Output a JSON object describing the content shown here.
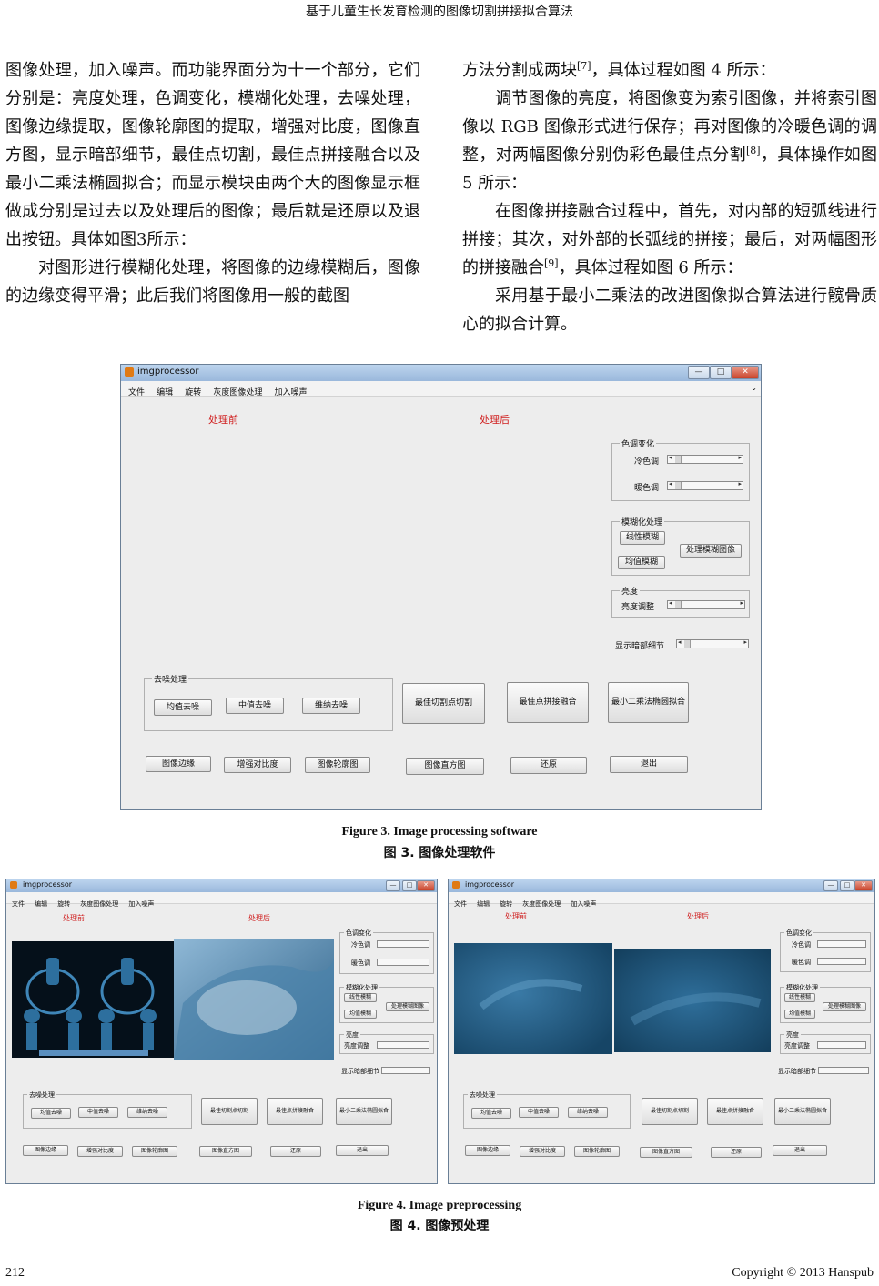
{
  "header": {
    "running_title": "基于儿童生长发育检测的图像切割拼接拟合算法"
  },
  "body": {
    "left": {
      "p1": "图像处理，加入噪声。而功能界面分为十一个部分，它们分别是：亮度处理，色调变化，模糊化处理，去噪处理，图像边缘提取，图像轮廓图的提取，增强对比度，图像直方图，显示暗部细节，最佳点切割，最佳点拼接融合以及最小二乘法椭圆拟合；而显示模块由两个大的图像显示框做成分别是过去以及处理后的图像；最后就是还原以及退出按钮。具体如图3所示：",
      "p2": "对图形进行模糊化处理，将图像的边缘模糊后，图像的边缘变得平滑；此后我们将图像用一般的截图"
    },
    "right": {
      "p1_a": "方法分割成两块",
      "p1_ref": "[7]",
      "p1_b": "，具体过程如图 4 所示：",
      "p2_a": "调节图像的亮度，将图像变为索引图像，并将索引图像以 RGB 图像形式进行保存；再对图像的冷暖色调的调整，对两幅图像分别伪彩色最佳点分割",
      "p2_ref": "[8]",
      "p2_b": "，具体操作如图 5 所示：",
      "p3_a": "在图像拼接融合过程中，首先，对内部的短弧线进行拼接；其次，对外部的长弧线的拼接；最后，对两幅图形的拼接融合",
      "p3_ref": "[9]",
      "p3_b": "，具体过程如图 6 所示：",
      "p4": "采用基于最小二乘法的改进图像拟合算法进行髋骨质心的拟合计算。"
    }
  },
  "app": {
    "title": "imgprocessor",
    "menu": [
      "文件",
      "编辑",
      "旋转",
      "灰度图像处理",
      "加入噪声"
    ],
    "before_label": "处理前",
    "after_label": "处理后",
    "tone_panel": "色调变化",
    "cool": "冷色调",
    "warm": "暖色调",
    "blur_panel": "模糊化处理",
    "linear_blur": "线性模糊",
    "mean_blur": "均值模糊",
    "process_blur": "处理模糊图像",
    "brightness_panel": "亮度",
    "brightness_adjust": "亮度调整",
    "dark_detail": "显示暗部细节",
    "denoise_panel": "去噪处理",
    "mean_denoise": "均值去噪",
    "median_denoise": "中值去噪",
    "wiener_denoise": "维纳去噪",
    "best_cut": "最佳切割点切割",
    "best_fuse": "最佳点拼接融合",
    "ellipse_fit": "最小二乘法椭圆拟合",
    "edge": "图像边缘",
    "contrast": "增强对比度",
    "contour": "图像轮廓图",
    "histogram": "图像直方图",
    "restore": "还原",
    "exit": "退出"
  },
  "fig3": {
    "en": "Figure 3. Image processing software",
    "cn": "图 3.  图像处理软件"
  },
  "fig4": {
    "en": "Figure 4. Image preprocessing",
    "cn": "图 4.  图像预处理"
  },
  "footer": {
    "page": "212",
    "copyright": "Copyright © 2013 Hanspub"
  }
}
